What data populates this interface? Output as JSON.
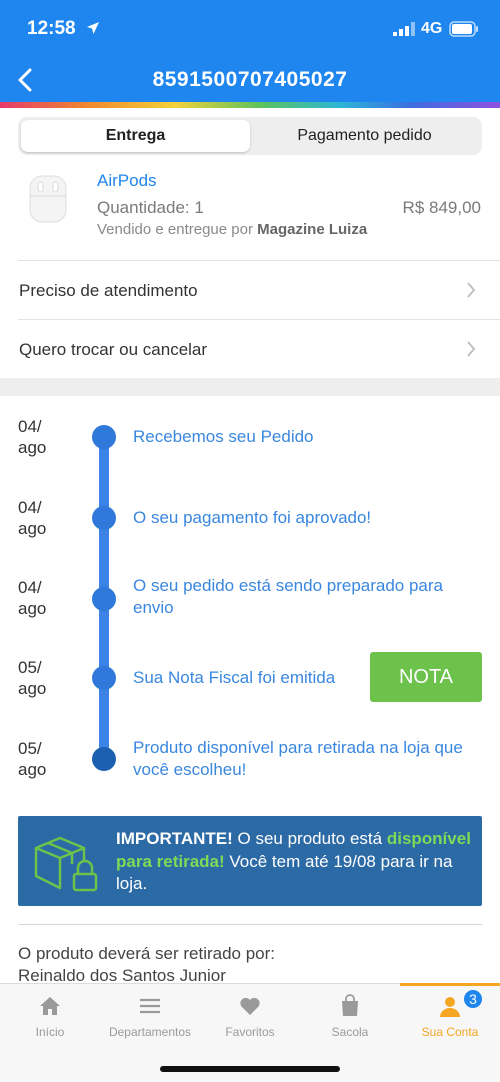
{
  "status_bar": {
    "time": "12:58",
    "network": "4G"
  },
  "nav": {
    "title": "8591500707405027"
  },
  "tabs": [
    {
      "label": "Entrega"
    },
    {
      "label": "Pagamento pedido"
    }
  ],
  "product": {
    "name": "AirPods",
    "quantity": "Quantidade: 1",
    "price": "R$ 849,00",
    "seller_prefix": "Vendido e entregue por ",
    "seller": "Magazine Luiza"
  },
  "menu": [
    {
      "label": "Preciso de atendimento"
    },
    {
      "label": "Quero trocar ou cancelar"
    }
  ],
  "timeline": [
    {
      "day": "04/",
      "month": "ago",
      "text": "Recebemos seu Pedido"
    },
    {
      "day": "04/",
      "month": "ago",
      "text": "O seu pagamento foi aprovado!"
    },
    {
      "day": "04/",
      "month": "ago",
      "text": "O seu pedido está sendo preparado para envio"
    },
    {
      "day": "05/",
      "month": "ago",
      "text": "Sua Nota Fiscal foi emitida"
    },
    {
      "day": "05/",
      "month": "ago",
      "text": "Produto disponível para retirada na loja que você escolheu!"
    }
  ],
  "nota_button": "NOTA",
  "notice": {
    "important": "IMPORTANTE!",
    "part1": " O seu produto está ",
    "highlight": "disponível para retirada!",
    "part2": " Você tem até 19/08 para ir na loja."
  },
  "pickup": {
    "label": "O produto deverá ser retirado por:",
    "name": "Reinaldo dos Santos Junior"
  },
  "tabbar": [
    {
      "label": "Início",
      "icon": "home-icon"
    },
    {
      "label": "Departamentos",
      "icon": "list-icon"
    },
    {
      "label": "Favoritos",
      "icon": "heart-icon"
    },
    {
      "label": "Sacola",
      "icon": "bag-icon"
    },
    {
      "label": "Sua Conta",
      "icon": "user-icon",
      "badge": "3"
    }
  ],
  "colors": {
    "primary": "#1f86f0",
    "success": "#6cc24a",
    "notice_bg": "#2c6aa6",
    "accent": "#f5a623"
  }
}
